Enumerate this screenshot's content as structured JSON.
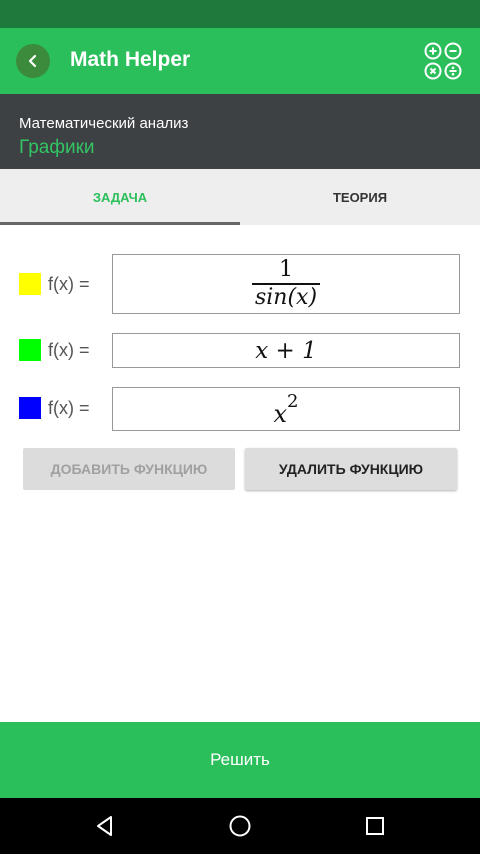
{
  "app": {
    "title": "Math Helper"
  },
  "header": {
    "section": "Математический анализ",
    "topic": "Графики"
  },
  "tabs": [
    {
      "label": "ЗАДАЧА",
      "active": true
    },
    {
      "label": "ТЕОРИЯ",
      "active": false
    }
  ],
  "functions": [
    {
      "label": "f(x) =",
      "color": "#ffff00",
      "numerator": "1",
      "denominator": "sin(x)"
    },
    {
      "label": "f(x) =",
      "color": "#00ff00",
      "expression": "x + 1"
    },
    {
      "label": "f(x) =",
      "color": "#0000ff",
      "base": "x",
      "exponent": "2"
    }
  ],
  "buttons": {
    "add": "ДОБАВИТЬ ФУНКЦИЮ",
    "delete": "УДАЛИТЬ ФУНКЦИЮ",
    "solve": "Решить"
  },
  "colors": {
    "primary": "#2bbf5c",
    "status_bar": "#1e7a3c",
    "header_bg": "#3d4144"
  },
  "icons": {
    "back": "chevron-left-icon",
    "calculator": "calculator-operations-icon",
    "nav": [
      "back-triangle-icon",
      "home-circle-icon",
      "recents-square-icon"
    ]
  }
}
